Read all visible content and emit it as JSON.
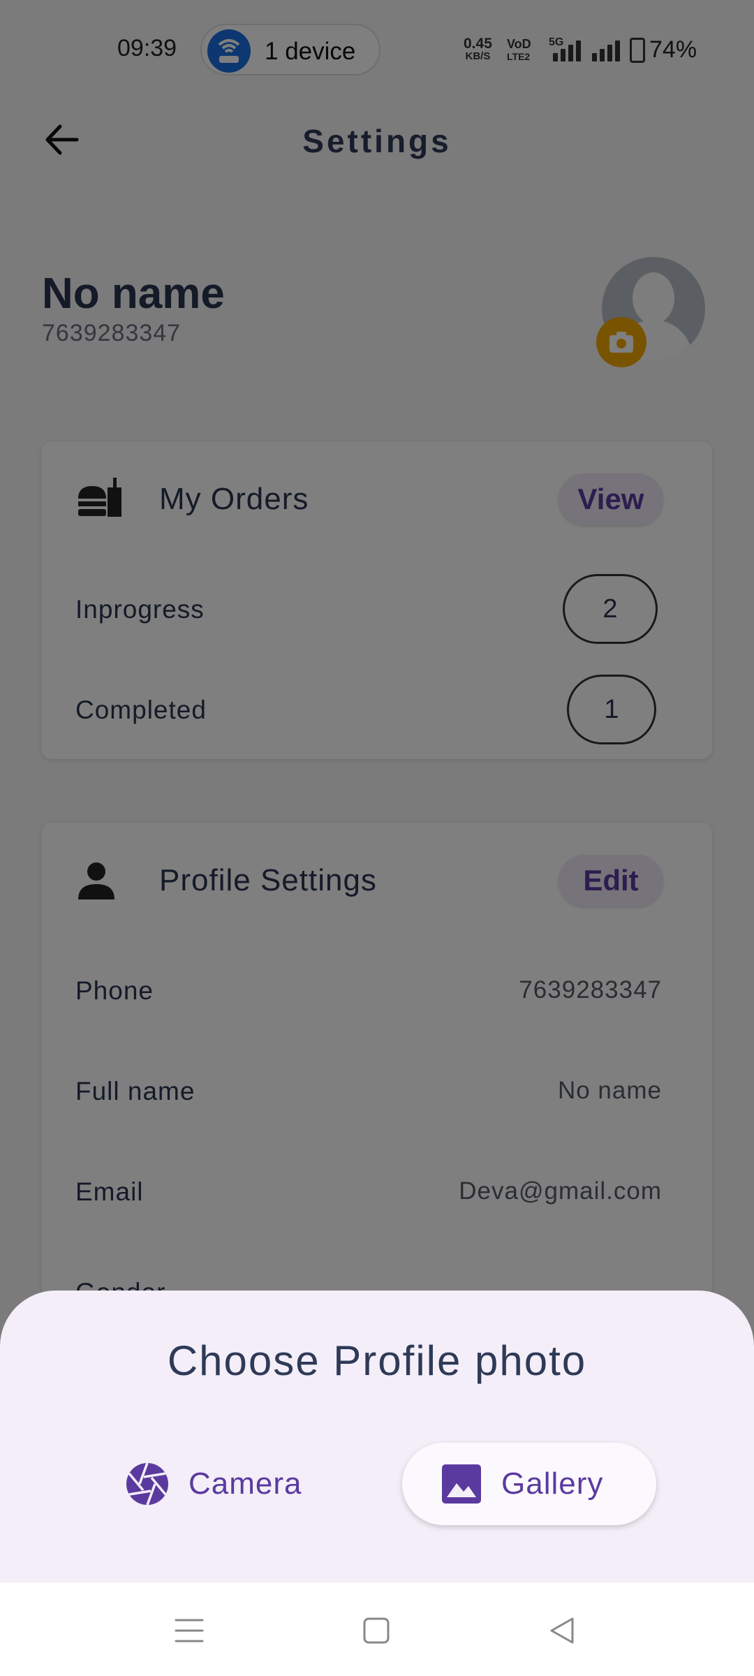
{
  "status_bar": {
    "time": "09:39",
    "hotspot": "1 device",
    "net_speed_value": "0.45",
    "net_speed_unit": "KB/S",
    "volte_top": "VoD",
    "volte_bottom": "LTE2",
    "network_type": "5G",
    "battery": "74%"
  },
  "app_bar": {
    "title": "Settings"
  },
  "profile": {
    "name": "No name",
    "phone": "7639283347"
  },
  "orders_card": {
    "title": "My Orders",
    "view_label": "View",
    "rows": [
      {
        "label": "Inprogress",
        "count": "2"
      },
      {
        "label": "Completed",
        "count": "1"
      }
    ]
  },
  "profile_card": {
    "title": "Profile Settings",
    "edit_label": "Edit",
    "rows": [
      {
        "label": "Phone",
        "value": "7639283347"
      },
      {
        "label": "Full name",
        "value": "No name"
      },
      {
        "label": "Email",
        "value": "Deva@gmail.com"
      },
      {
        "label": "Gender",
        "value": ""
      }
    ]
  },
  "sheet": {
    "title": "Choose Profile photo",
    "camera_label": "Camera",
    "gallery_label": "Gallery"
  },
  "colors": {
    "accent": "#5b3a9f",
    "badge": "#f2a900",
    "sheet_bg": "#f3eef8"
  },
  "icons": [
    "back-arrow-icon",
    "hotspot-icon",
    "camera-icon",
    "burger-drink-icon",
    "person-icon",
    "aperture-icon",
    "image-icon",
    "menu-icon",
    "home-icon",
    "back-icon"
  ]
}
